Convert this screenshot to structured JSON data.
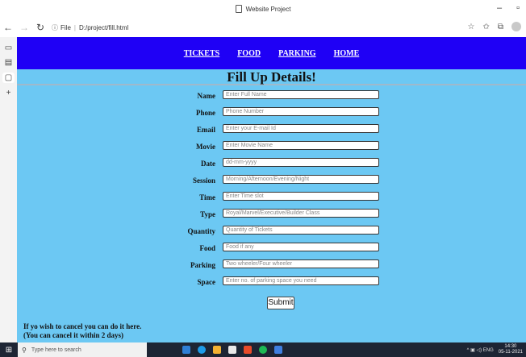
{
  "window": {
    "title": "Website Project",
    "controls": {
      "minimize": "–",
      "maximize": "▫"
    }
  },
  "addressbar": {
    "back": "←",
    "forward": "→",
    "refresh": "↻",
    "info": "ⓘ",
    "scheme": "File",
    "path": "D:/project/fill.html",
    "tools": [
      "☆",
      "✩",
      "⧉"
    ]
  },
  "rail": {
    "items": [
      "▭",
      "▤",
      "▢",
      "+"
    ]
  },
  "page": {
    "nav": [
      "TICKETS",
      "FOOD",
      "PARKING",
      "HOME"
    ],
    "heading": "Fill Up Details!",
    "fields": [
      {
        "label": "Name",
        "placeholder": "Enter Full Name"
      },
      {
        "label": "Phone",
        "placeholder": "Phone Number"
      },
      {
        "label": "Email",
        "placeholder": "Enter your E-mail Id"
      },
      {
        "label": "Movie",
        "placeholder": "Enter Movie Name"
      },
      {
        "label": "Date",
        "placeholder": "dd-mm-yyyy"
      },
      {
        "label": "Session",
        "placeholder": "Morning/Afternoon/Evening/Night"
      },
      {
        "label": "Time",
        "placeholder": "Enter Time slot"
      },
      {
        "label": "Type",
        "placeholder": "Royal/Marvel/Executive/Builder Class"
      },
      {
        "label": "Quantity",
        "placeholder": "Quantity of Tickets"
      },
      {
        "label": "Food",
        "placeholder": "Food if any"
      },
      {
        "label": "Parking",
        "placeholder": "Two wheeler/Four wheeler"
      },
      {
        "label": "Space",
        "placeholder": "Enter no. of parking space you need"
      }
    ],
    "submit_label": "Submit",
    "cancel_line1": "If yo wish to cancel you can do it here.",
    "cancel_line2": "(You can cancel it within 2 days)"
  },
  "taskbar": {
    "search_placeholder": "Type here to search",
    "tray_text": "^ ▣ ◁) ENG",
    "time": "14:30",
    "date": "05-11-2021",
    "app_colors": [
      "#2f7fd6",
      "#1e9be8",
      "#f2b233",
      "#e9e9e9",
      "#e84b2a",
      "#1db954",
      "#3f7fe0"
    ]
  },
  "colors": {
    "navbar": "#1f00f5",
    "page_bg": "#6cc8f3",
    "taskbar": "#1d2534"
  }
}
